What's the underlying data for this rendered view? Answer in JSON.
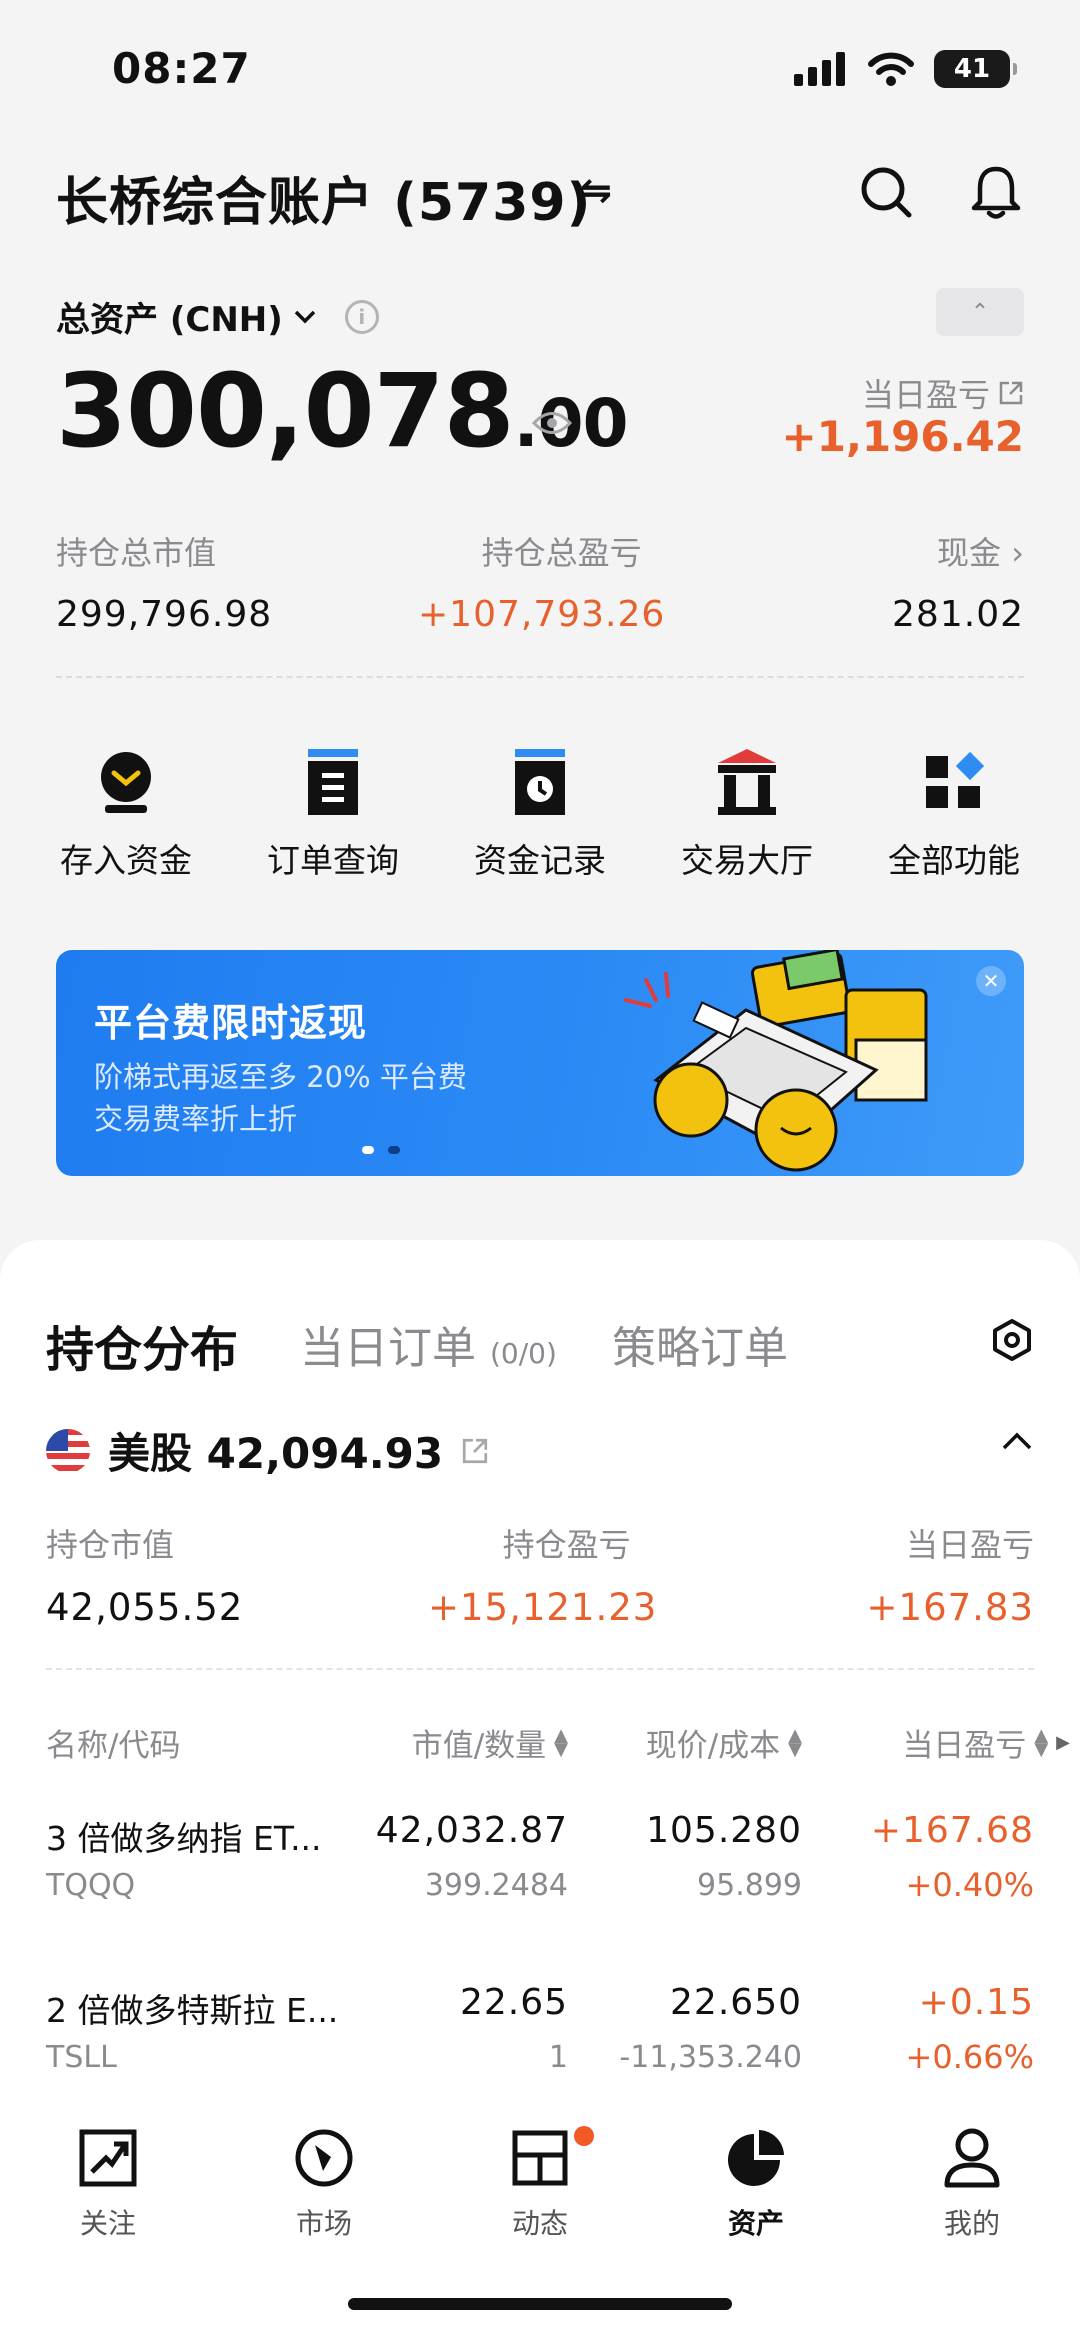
{
  "status_bar": {
    "time": "08:27",
    "battery": "41"
  },
  "header": {
    "account_title": "长桥综合账户 (5739)",
    "swap_symbol": "⇋"
  },
  "assets": {
    "total_label": "总资产 (CNH)",
    "total_integer": "300,078",
    "total_decimal": ".00",
    "day_pnl_label": "当日盈亏",
    "day_pnl_value": "+1,196.42",
    "market_value_label": "持仓总市值",
    "market_value": "299,796.98",
    "position_pnl_label": "持仓总盈亏",
    "position_pnl": "+107,793.26",
    "cash_label": "现金",
    "cash_value": "281.02"
  },
  "quick_actions": [
    {
      "label": "存入资金",
      "icon": "deposit-icon"
    },
    {
      "label": "订单查询",
      "icon": "order-query-icon"
    },
    {
      "label": "资金记录",
      "icon": "fund-record-icon"
    },
    {
      "label": "交易大厅",
      "icon": "trading-hall-icon"
    },
    {
      "label": "全部功能",
      "icon": "all-functions-icon"
    }
  ],
  "banner": {
    "title": "平台费限时返现",
    "line1": "阶梯式再返至多 20% 平台费",
    "line2": "交易费率折上折"
  },
  "tabs": {
    "holdings": "持仓分布",
    "day_orders": "当日订单",
    "day_orders_count": "(0/0)",
    "strategy_orders": "策略订单"
  },
  "us_section": {
    "title": "美股 42,094.93",
    "market_value_label": "持仓市值",
    "market_value": "42,055.52",
    "pnl_label": "持仓盈亏",
    "pnl": "+15,121.23",
    "day_pnl_label": "当日盈亏",
    "day_pnl": "+167.83"
  },
  "table": {
    "headers": {
      "name": "名称/代码",
      "mv_qty": "市值/数量",
      "price_cost": "现价/成本",
      "day_pnl": "当日盈亏"
    },
    "rows": [
      {
        "name": "3 倍做多纳指 ET...",
        "code": "TQQQ",
        "market_value": "42,032.87",
        "quantity": "399.2484",
        "price": "105.280",
        "cost": "95.899",
        "day_pnl": "+167.68",
        "day_pct": "+0.40%"
      },
      {
        "name": "2 倍做多特斯拉 E...",
        "code": "TSLL",
        "market_value": "22.65",
        "quantity": "1",
        "price": "22.650",
        "cost": "-11,353.240",
        "day_pnl": "+0.15",
        "day_pct": "+0.66%"
      }
    ]
  },
  "bottom_nav": [
    {
      "label": "关注",
      "icon": "watchlist-icon"
    },
    {
      "label": "市场",
      "icon": "market-icon"
    },
    {
      "label": "动态",
      "icon": "feed-icon"
    },
    {
      "label": "资产",
      "icon": "assets-icon"
    },
    {
      "label": "我的",
      "icon": "profile-icon"
    }
  ],
  "colors": {
    "accent_orange": "#e8602c",
    "banner_blue": "#1f7cf0",
    "active_badge": "#f05a24"
  }
}
